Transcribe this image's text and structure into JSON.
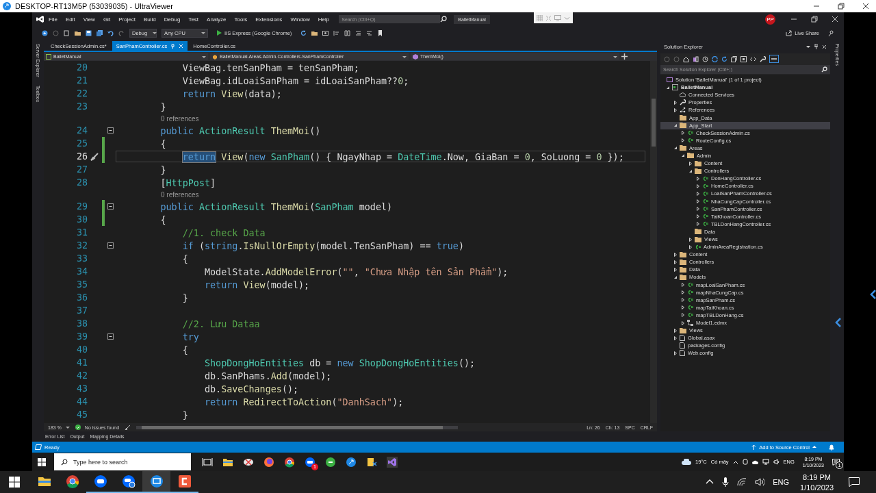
{
  "remote_window": {
    "title": "DESKTOP-RT13M5P (53039035) - UltraViewer"
  },
  "vs": {
    "menu": [
      "File",
      "Edit",
      "View",
      "Git",
      "Project",
      "Build",
      "Debug",
      "Test",
      "Analyze",
      "Tools",
      "Extensions",
      "Window",
      "Help"
    ],
    "search": {
      "placeholder": "Search (Ctrl+Q)"
    },
    "solution_name": "BalletManual",
    "account_initials": "PP",
    "toolbar": {
      "configuration": "Debug",
      "platform": "Any CPU",
      "run_target": "IIS Express (Google Chrome)",
      "live_share": "Live Share"
    },
    "left_tool_tabs": [
      "Server Explorer",
      "Toolbox"
    ],
    "right_tool_tabs": [
      "Properties"
    ],
    "editor": {
      "tabs": [
        {
          "label": "CheckSessionAdmin.cs*",
          "selected": false
        },
        {
          "label": "SanPhamController.cs",
          "selected": true
        },
        {
          "label": "HomeController.cs",
          "selected": false
        }
      ],
      "nav": {
        "project": "BalletManual",
        "class": "BalletManual.Areas.Admin.Controllers.SanPhamController",
        "member": "ThemMoi()"
      },
      "lines": [
        {
          "kind": "code",
          "number": "20",
          "collapsible": false,
          "changed": false,
          "current": false,
          "tokens": [
            {
              "kind": "plain",
              "text": "            ViewBag.tenSanPham = tenSanPham;"
            }
          ]
        },
        {
          "kind": "code",
          "number": "21",
          "collapsible": false,
          "changed": false,
          "current": false,
          "tokens": [
            {
              "kind": "plain",
              "text": "            ViewBag.idLoaiSanPham = idLoaiSanPham??"
            },
            {
              "kind": "num",
              "text": "0"
            },
            {
              "kind": "plain",
              "text": ";"
            }
          ]
        },
        {
          "kind": "code",
          "number": "22",
          "collapsible": false,
          "changed": false,
          "current": false,
          "tokens": [
            {
              "kind": "kw",
              "text": "            return"
            },
            {
              "kind": "method",
              "text": " View"
            },
            {
              "kind": "plain",
              "text": "(data);"
            }
          ]
        },
        {
          "kind": "code",
          "number": "23",
          "collapsible": false,
          "changed": false,
          "current": false,
          "tokens": [
            {
              "kind": "plain",
              "text": "        }"
            }
          ]
        },
        {
          "kind": "lens",
          "text": "0 references"
        },
        {
          "kind": "code",
          "number": "24",
          "collapsible": true,
          "changed": false,
          "current": false,
          "tokens": [
            {
              "kind": "kw",
              "text": "        public"
            },
            {
              "kind": "type",
              "text": " ActionResult"
            },
            {
              "kind": "method",
              "text": " ThemMoi"
            },
            {
              "kind": "plain",
              "text": "()"
            }
          ]
        },
        {
          "kind": "code",
          "number": "25",
          "collapsible": false,
          "changed": true,
          "current": false,
          "tokens": [
            {
              "kind": "plain",
              "text": "        {"
            }
          ]
        },
        {
          "kind": "code",
          "number": "26",
          "collapsible": false,
          "changed": true,
          "current": true,
          "tokens": [
            {
              "kind": "kw-selected",
              "text": "            return"
            },
            {
              "kind": "method",
              "text": " View"
            },
            {
              "kind": "plain",
              "text": "("
            },
            {
              "kind": "kw",
              "text": "new"
            },
            {
              "kind": "type",
              "text": " SanPham"
            },
            {
              "kind": "plain",
              "text": "() { NgayNhap = "
            },
            {
              "kind": "type",
              "text": "DateTime"
            },
            {
              "kind": "plain",
              "text": ".Now, GiaBan = "
            },
            {
              "kind": "num",
              "text": "0"
            },
            {
              "kind": "plain",
              "text": ", SoLuong = "
            },
            {
              "kind": "num",
              "text": "0"
            },
            {
              "kind": "plain",
              "text": " });"
            }
          ]
        },
        {
          "kind": "code",
          "number": "27",
          "collapsible": false,
          "changed": false,
          "current": false,
          "tokens": [
            {
              "kind": "plain",
              "text": "        }"
            }
          ]
        },
        {
          "kind": "code",
          "number": "28",
          "collapsible": false,
          "changed": false,
          "current": false,
          "tokens": [
            {
              "kind": "plain",
              "text": "        ["
            },
            {
              "kind": "type",
              "text": "HttpPost"
            },
            {
              "kind": "plain",
              "text": "]"
            }
          ]
        },
        {
          "kind": "lens",
          "text": "0 references"
        },
        {
          "kind": "code",
          "number": "29",
          "collapsible": true,
          "changed": true,
          "current": false,
          "tokens": [
            {
              "kind": "kw",
              "text": "        public"
            },
            {
              "kind": "type",
              "text": " ActionResult"
            },
            {
              "kind": "method",
              "text": " ThemMoi"
            },
            {
              "kind": "plain",
              "text": "("
            },
            {
              "kind": "type",
              "text": "SanPham"
            },
            {
              "kind": "plain",
              "text": " model)"
            }
          ]
        },
        {
          "kind": "code",
          "number": "30",
          "collapsible": false,
          "changed": true,
          "current": false,
          "tokens": [
            {
              "kind": "plain",
              "text": "        {"
            }
          ]
        },
        {
          "kind": "code",
          "number": "31",
          "collapsible": false,
          "changed": false,
          "current": false,
          "tokens": [
            {
              "kind": "comment",
              "text": "            //1. check Data"
            }
          ]
        },
        {
          "kind": "code",
          "number": "32",
          "collapsible": true,
          "changed": false,
          "current": false,
          "tokens": [
            {
              "kind": "kw",
              "text": "            if"
            },
            {
              "kind": "plain",
              "text": " ("
            },
            {
              "kind": "kw",
              "text": "string"
            },
            {
              "kind": "plain",
              "text": "."
            },
            {
              "kind": "method",
              "text": "IsNullOrEmpty"
            },
            {
              "kind": "plain",
              "text": "(model.TenSanPham) == "
            },
            {
              "kind": "kw",
              "text": "true"
            },
            {
              "kind": "plain",
              "text": ")"
            }
          ]
        },
        {
          "kind": "code",
          "number": "33",
          "collapsible": false,
          "changed": false,
          "current": false,
          "tokens": [
            {
              "kind": "plain",
              "text": "            {"
            }
          ]
        },
        {
          "kind": "code",
          "number": "34",
          "collapsible": false,
          "changed": false,
          "current": false,
          "tokens": [
            {
              "kind": "plain",
              "text": "                ModelState."
            },
            {
              "kind": "method",
              "text": "AddModelError"
            },
            {
              "kind": "plain",
              "text": "("
            },
            {
              "kind": "str",
              "text": "\"\""
            },
            {
              "kind": "plain",
              "text": ", "
            },
            {
              "kind": "str",
              "text": "\"Chưa Nhập tên Sản Phẩm\""
            },
            {
              "kind": "plain",
              "text": ");"
            }
          ]
        },
        {
          "kind": "code",
          "number": "35",
          "collapsible": false,
          "changed": false,
          "current": false,
          "tokens": [
            {
              "kind": "kw",
              "text": "                return"
            },
            {
              "kind": "method",
              "text": " View"
            },
            {
              "kind": "plain",
              "text": "(model);"
            }
          ]
        },
        {
          "kind": "code",
          "number": "36",
          "collapsible": false,
          "changed": false,
          "current": false,
          "tokens": [
            {
              "kind": "plain",
              "text": "            }"
            }
          ]
        },
        {
          "kind": "code",
          "number": "37",
          "collapsible": false,
          "changed": false,
          "current": false
        },
        {
          "kind": "code",
          "number": "38",
          "collapsible": false,
          "changed": false,
          "current": false,
          "tokens": [
            {
              "kind": "comment",
              "text": "            //2. Lưu Dataa"
            }
          ]
        },
        {
          "kind": "code",
          "number": "39",
          "collapsible": true,
          "changed": false,
          "current": false,
          "tokens": [
            {
              "kind": "kw",
              "text": "            try"
            }
          ]
        },
        {
          "kind": "code",
          "number": "40",
          "collapsible": false,
          "changed": false,
          "current": false,
          "tokens": [
            {
              "kind": "plain",
              "text": "            {"
            }
          ]
        },
        {
          "kind": "code",
          "number": "41",
          "collapsible": false,
          "changed": false,
          "current": false,
          "tokens": [
            {
              "kind": "type",
              "text": "                ShopDongHoEntities"
            },
            {
              "kind": "plain",
              "text": " db = "
            },
            {
              "kind": "kw",
              "text": "new"
            },
            {
              "kind": "type",
              "text": " ShopDongHoEntities"
            },
            {
              "kind": "plain",
              "text": "();"
            }
          ]
        },
        {
          "kind": "code",
          "number": "42",
          "collapsible": false,
          "changed": false,
          "current": false,
          "tokens": [
            {
              "kind": "plain",
              "text": "                db.SanPhams."
            },
            {
              "kind": "method",
              "text": "Add"
            },
            {
              "kind": "plain",
              "text": "(model);"
            }
          ]
        },
        {
          "kind": "code",
          "number": "43",
          "collapsible": false,
          "changed": false,
          "current": false,
          "tokens": [
            {
              "kind": "plain",
              "text": "                db."
            },
            {
              "kind": "method",
              "text": "SaveChanges"
            },
            {
              "kind": "plain",
              "text": "();"
            }
          ]
        },
        {
          "kind": "code",
          "number": "44",
          "collapsible": false,
          "changed": false,
          "current": false,
          "tokens": [
            {
              "kind": "kw",
              "text": "                return"
            },
            {
              "kind": "method",
              "text": " RedirectToAction"
            },
            {
              "kind": "plain",
              "text": "("
            },
            {
              "kind": "str",
              "text": "\"DanhSach\""
            },
            {
              "kind": "plain",
              "text": ");"
            }
          ]
        },
        {
          "kind": "code",
          "number": "45",
          "collapsible": false,
          "changed": false,
          "current": false,
          "tokens": [
            {
              "kind": "plain",
              "text": "            }"
            }
          ]
        }
      ],
      "status": {
        "zoom": "183 %",
        "issues": "No issues found",
        "line": "Ln: 26",
        "column": "Ch: 13",
        "whitespace": "SPC",
        "line_ending": "CRLF"
      }
    },
    "solution_explorer": {
      "title": "Solution Explorer",
      "search": {
        "placeholder": "Search Solution Explorer (Ctrl+;)"
      },
      "tree": [
        {
          "label": "Solution 'BalletManual' (1 of 1 project)",
          "kind": "solution",
          "selected": false,
          "children": [
            {
              "label": "BalletManual",
              "kind": "project",
              "expanded": true,
              "selected": false,
              "children": [
                {
                  "label": "Connected Services",
                  "kind": "service",
                  "selected": false
                },
                {
                  "label": "Properties",
                  "kind": "props",
                  "expanded": false,
                  "selected": false
                },
                {
                  "label": "References",
                  "kind": "refs",
                  "expanded": false,
                  "selected": false
                },
                {
                  "label": "App_Data",
                  "kind": "folder",
                  "selected": false
                },
                {
                  "label": "App_Start",
                  "kind": "folder",
                  "expanded": true,
                  "selected": true,
                  "children": [
                    {
                      "label": "CheckSessionAdmin.cs",
                      "kind": "cs",
                      "expanded": false,
                      "selected": false
                    },
                    {
                      "label": "RouteConfig.cs",
                      "kind": "cs",
                      "expanded": false,
                      "selected": false
                    }
                  ]
                },
                {
                  "label": "Areas",
                  "kind": "folder",
                  "expanded": true,
                  "selected": false,
                  "children": [
                    {
                      "label": "Admin",
                      "kind": "folder",
                      "expanded": true,
                      "selected": false,
                      "children": [
                        {
                          "label": "Content",
                          "kind": "folder",
                          "expanded": false,
                          "selected": false
                        },
                        {
                          "label": "Controllers",
                          "kind": "folder",
                          "expanded": true,
                          "selected": false,
                          "children": [
                            {
                              "label": "DonHangController.cs",
                              "kind": "cs",
                              "expanded": false,
                              "selected": false
                            },
                            {
                              "label": "HomeController.cs",
                              "kind": "cs",
                              "expanded": false,
                              "selected": false
                            },
                            {
                              "label": "LoaiSanPhamController.cs",
                              "kind": "cs",
                              "expanded": false,
                              "selected": false
                            },
                            {
                              "label": "NhaCungCapController.cs",
                              "kind": "cs",
                              "expanded": false,
                              "selected": false
                            },
                            {
                              "label": "SanPhamController.cs",
                              "kind": "cs",
                              "expanded": false,
                              "selected": false
                            },
                            {
                              "label": "TaiKhoanController.cs",
                              "kind": "cs",
                              "expanded": false,
                              "selected": false
                            },
                            {
                              "label": "TBLDonHangController.cs",
                              "kind": "cs",
                              "expanded": false,
                              "selected": false
                            }
                          ]
                        },
                        {
                          "label": "Data",
                          "kind": "folder",
                          "selected": false
                        },
                        {
                          "label": "Views",
                          "kind": "folder",
                          "expanded": false,
                          "selected": false
                        },
                        {
                          "label": "AdminAreaRegistration.cs",
                          "kind": "cs",
                          "expanded": false,
                          "selected": false
                        }
                      ]
                    }
                  ]
                },
                {
                  "label": "Content",
                  "kind": "folder",
                  "expanded": false,
                  "selected": false
                },
                {
                  "label": "Controllers",
                  "kind": "folder",
                  "expanded": false,
                  "selected": false
                },
                {
                  "label": "Data",
                  "kind": "folder",
                  "expanded": false,
                  "selected": false
                },
                {
                  "label": "Models",
                  "kind": "folder",
                  "expanded": true,
                  "selected": false,
                  "children": [
                    {
                      "label": "mapLoaiSanPham.cs",
                      "kind": "cs",
                      "expanded": false,
                      "selected": false
                    },
                    {
                      "label": "mapNhaCungCap.cs",
                      "kind": "cs",
                      "expanded": false,
                      "selected": false
                    },
                    {
                      "label": "mapSanPham.cs",
                      "kind": "cs",
                      "expanded": false,
                      "selected": false
                    },
                    {
                      "label": "mapTaiKhoan.cs",
                      "kind": "cs",
                      "expanded": false,
                      "selected": false
                    },
                    {
                      "label": "mapTBLDonHang.cs",
                      "kind": "cs",
                      "expanded": false,
                      "selected": false
                    },
                    {
                      "label": "Model1.edmx",
                      "kind": "edmx",
                      "expanded": false,
                      "selected": false
                    }
                  ]
                },
                {
                  "label": "Views",
                  "kind": "folder",
                  "expanded": false,
                  "selected": false
                },
                {
                  "label": "Global.asax",
                  "kind": "doc",
                  "expanded": false,
                  "selected": false
                },
                {
                  "label": "packages.config",
                  "kind": "doc",
                  "selected": false
                },
                {
                  "label": "Web.config",
                  "kind": "doc",
                  "expanded": false,
                  "selected": false
                }
              ]
            }
          ]
        }
      ]
    },
    "bottom_tabs": [
      "Error List",
      "Output",
      "Mapping Details"
    ],
    "status_bar": {
      "state": "Ready",
      "source_control": "Add to Source Control"
    }
  },
  "remote_taskbar": {
    "search": {
      "placeholder": "Type here to search"
    },
    "chat_badge": "1",
    "weather": {
      "temperature": "19°C",
      "condition": "Có mây"
    },
    "language": "ENG",
    "time": "8:19 PM",
    "date": "1/10/2023",
    "notification_count": "1"
  },
  "taskbar": {
    "language": "ENG",
    "time": "8:19 PM",
    "date": "1/10/2023"
  }
}
